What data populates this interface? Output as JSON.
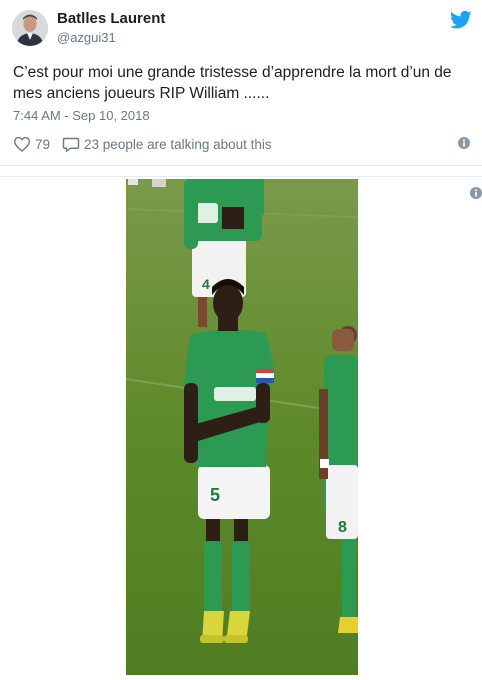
{
  "tweet": {
    "author_name": "Batlles Laurent",
    "author_handle": "@azgui31",
    "text": "C’est pour moi une grande tristesse d’apprendre la mort d’un de mes anciens joueurs RIP William ......",
    "timestamp": "7:44 AM - Sep 10, 2018",
    "like_count": "79",
    "talking_text": "23 people are talking about this"
  },
  "icons": {
    "brand": "twitter-bird-icon",
    "like": "heart-icon",
    "reply": "speech-bubble-icon",
    "info": "info-icon"
  },
  "colors": {
    "brand_blue": "#1da1f2",
    "secondary_text": "#697882",
    "jersey_green": "#2c9a52",
    "pitch_green": "#5e8a2c"
  }
}
